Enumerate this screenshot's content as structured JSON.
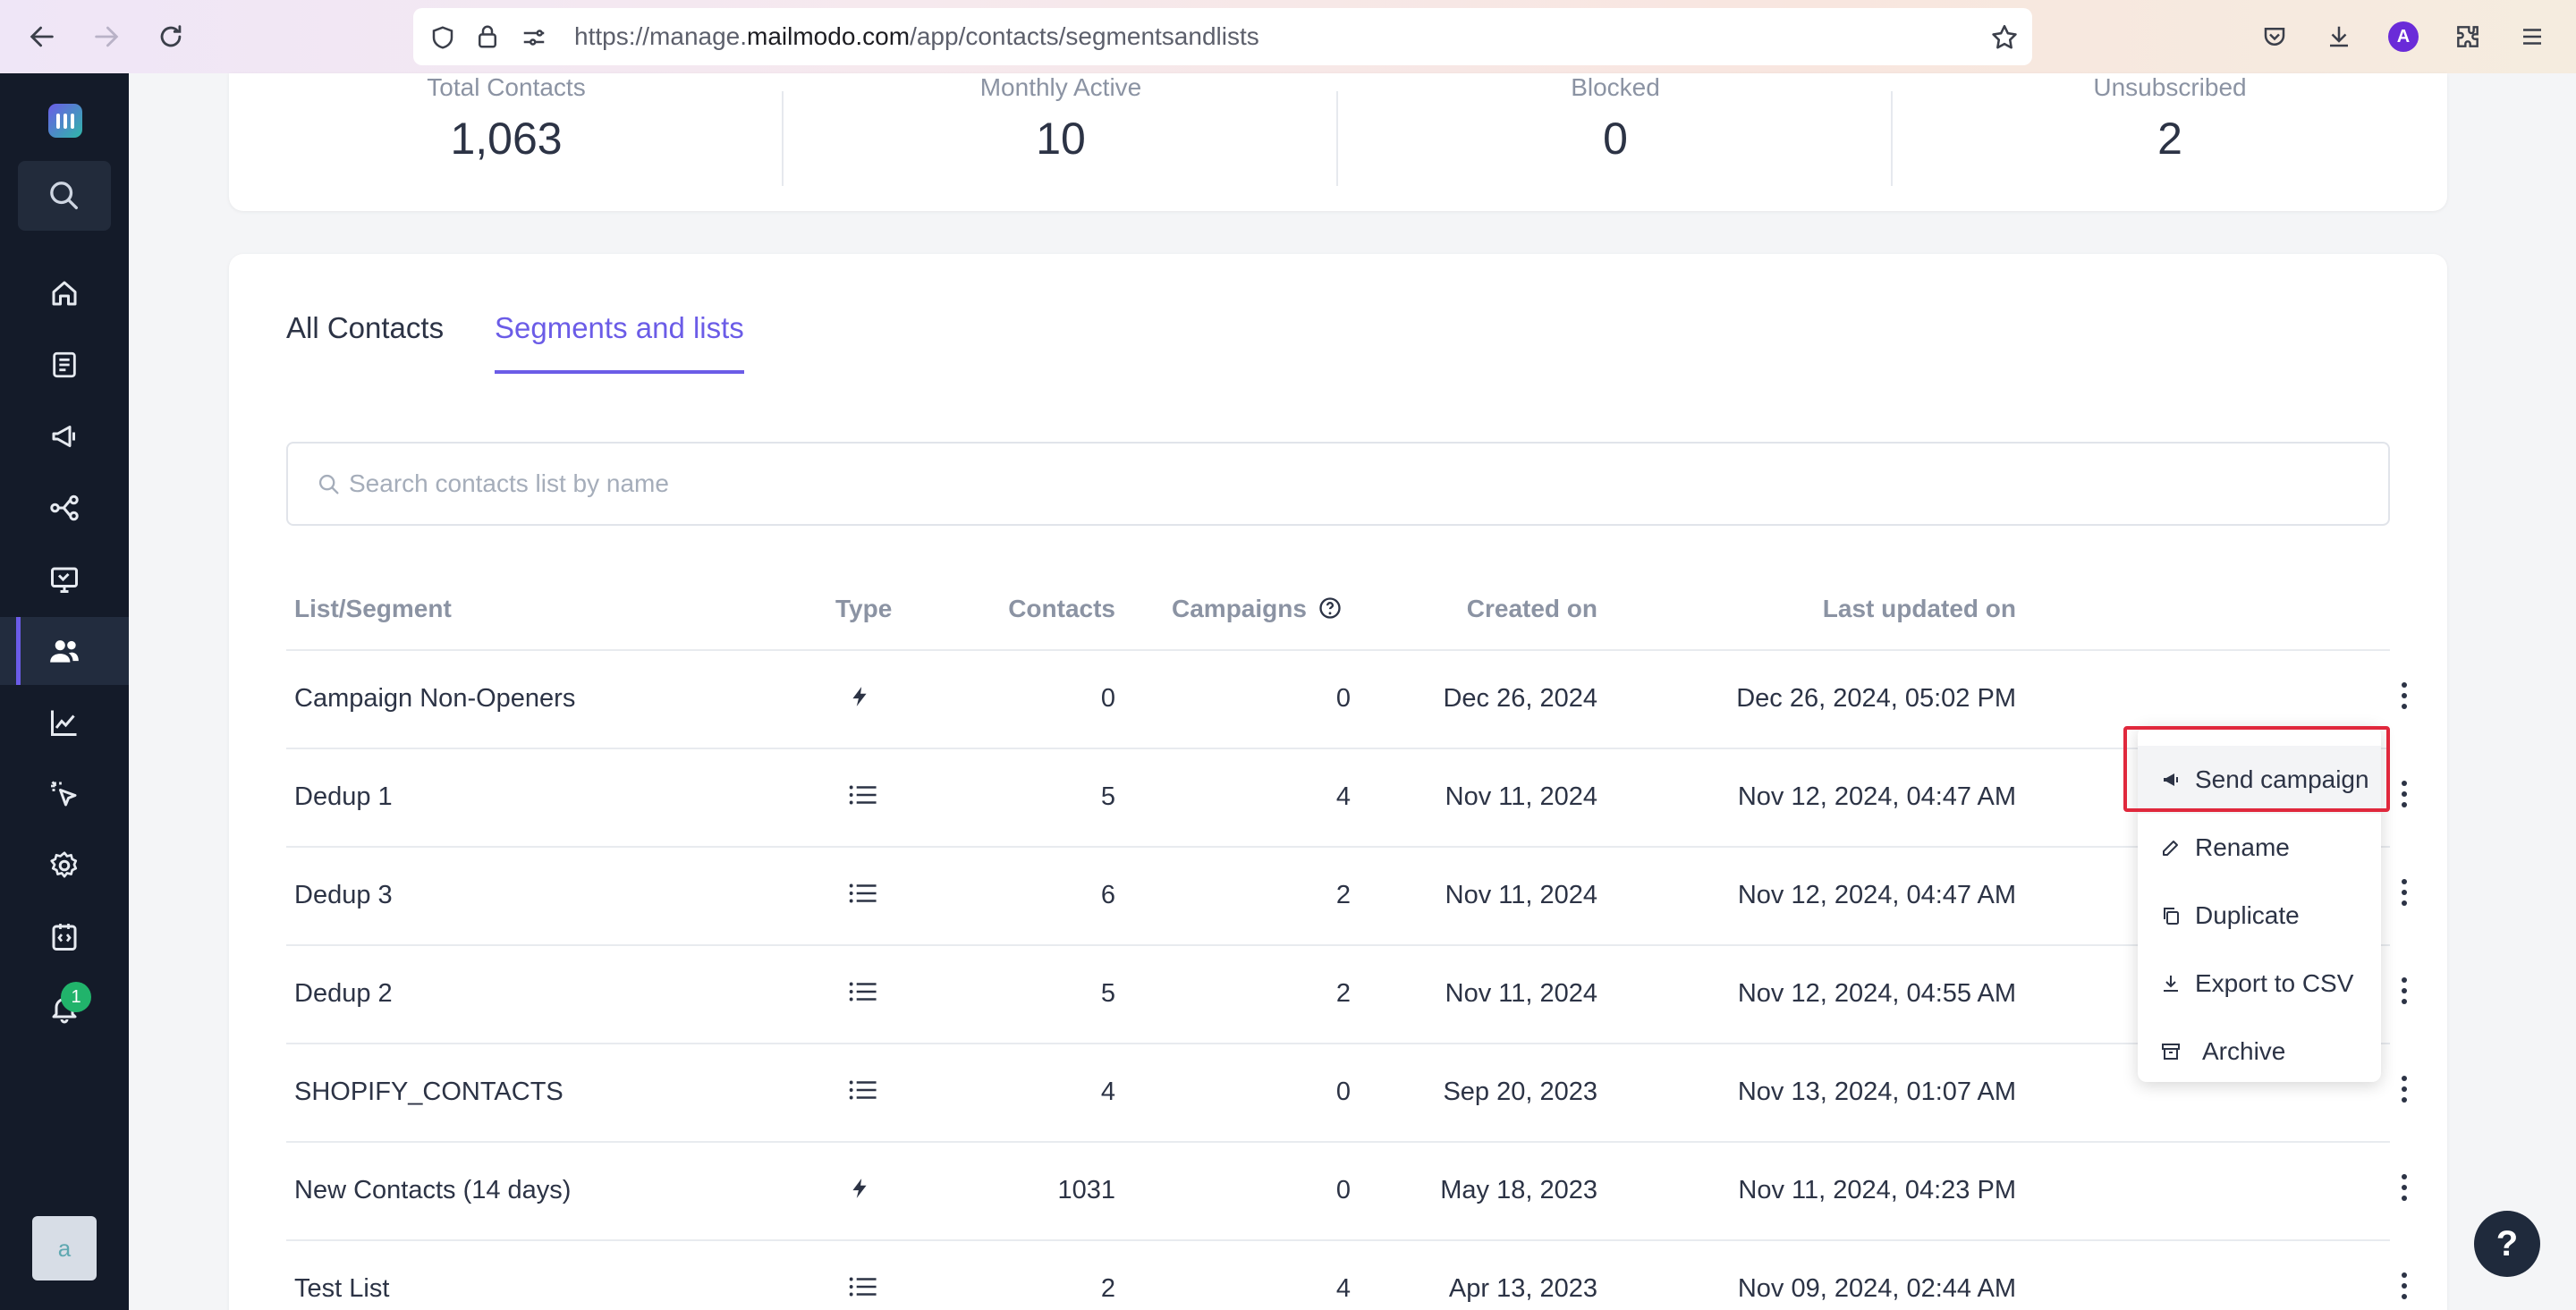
{
  "browser": {
    "url_prefix": "https://manage.",
    "url_domain": "mailmodo.com",
    "url_path": "/app/contacts/segmentsandlists",
    "profile_initial": "A"
  },
  "sidebar": {
    "notification_count": "1",
    "user_initial": "a",
    "active_item": "contacts"
  },
  "stats": [
    {
      "label": "Total Contacts",
      "value": "1,063"
    },
    {
      "label": "Monthly Active",
      "value": "10"
    },
    {
      "label": "Blocked",
      "value": "0"
    },
    {
      "label": "Unsubscribed",
      "value": "2"
    }
  ],
  "tabs": {
    "all_contacts": "All Contacts",
    "segments_lists": "Segments and lists"
  },
  "search": {
    "placeholder": "Search contacts list by name"
  },
  "table": {
    "headers": {
      "name": "List/Segment",
      "type": "Type",
      "contacts": "Contacts",
      "campaigns": "Campaigns",
      "created": "Created on",
      "updated": "Last updated on"
    },
    "rows": [
      {
        "name": "Campaign Non-Openers",
        "type": "segment",
        "contacts": "0",
        "campaigns": "0",
        "created": "Dec 26, 2024",
        "updated": "Dec 26, 2024, 05:02 PM"
      },
      {
        "name": "Dedup 1",
        "type": "list",
        "contacts": "5",
        "campaigns": "4",
        "created": "Nov 11, 2024",
        "updated": "Nov 12, 2024, 04:47 AM"
      },
      {
        "name": "Dedup 3",
        "type": "list",
        "contacts": "6",
        "campaigns": "2",
        "created": "Nov 11, 2024",
        "updated": "Nov 12, 2024, 04:47 AM"
      },
      {
        "name": "Dedup 2",
        "type": "list",
        "contacts": "5",
        "campaigns": "2",
        "created": "Nov 11, 2024",
        "updated": "Nov 12, 2024, 04:55 AM"
      },
      {
        "name": "SHOPIFY_CONTACTS",
        "type": "list",
        "contacts": "4",
        "campaigns": "0",
        "created": "Sep 20, 2023",
        "updated": "Nov 13, 2024, 01:07 AM"
      },
      {
        "name": "New Contacts (14 days)",
        "type": "segment",
        "contacts": "1031",
        "campaigns": "0",
        "created": "May 18, 2023",
        "updated": "Nov 11, 2024, 04:23 PM"
      },
      {
        "name": "Test List",
        "type": "list",
        "contacts": "2",
        "campaigns": "4",
        "created": "Apr 13, 2023",
        "updated": "Nov 09, 2024, 02:44 AM"
      }
    ]
  },
  "context_menu": {
    "items": [
      {
        "label": "Send campaign",
        "icon": "megaphone-icon"
      },
      {
        "label": "Rename",
        "icon": "pencil-icon"
      },
      {
        "label": "Duplicate",
        "icon": "copy-icon"
      },
      {
        "label": "Export to CSV",
        "icon": "download-icon"
      },
      {
        "label": "Archive",
        "icon": "archive-icon"
      }
    ]
  },
  "colors": {
    "accent": "#6b5ce7",
    "sidebar_bg": "#141b29",
    "highlight_border": "#e0283c"
  },
  "help": {
    "label": "?"
  }
}
